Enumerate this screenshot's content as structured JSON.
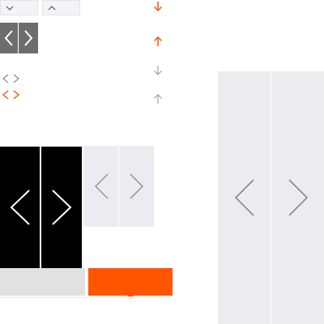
{
  "colors": {
    "accent": "#ff5500",
    "arrow_gray": "#9a9a9a",
    "chevron_gray": "#888888",
    "dark_button": "#6d6d6d",
    "black_panel": "#000000",
    "light_panel": "#ececf0",
    "grey_bar": "#e1e1e1"
  },
  "icons": {
    "dropdown_down": "chevron-down-icon",
    "dropdown_up": "chevron-up-icon",
    "nav_prev": "chevron-left-icon",
    "nav_next": "chevron-right-icon",
    "arrow_down": "arrow-down-icon",
    "arrow_up": "arrow-up-icon"
  }
}
